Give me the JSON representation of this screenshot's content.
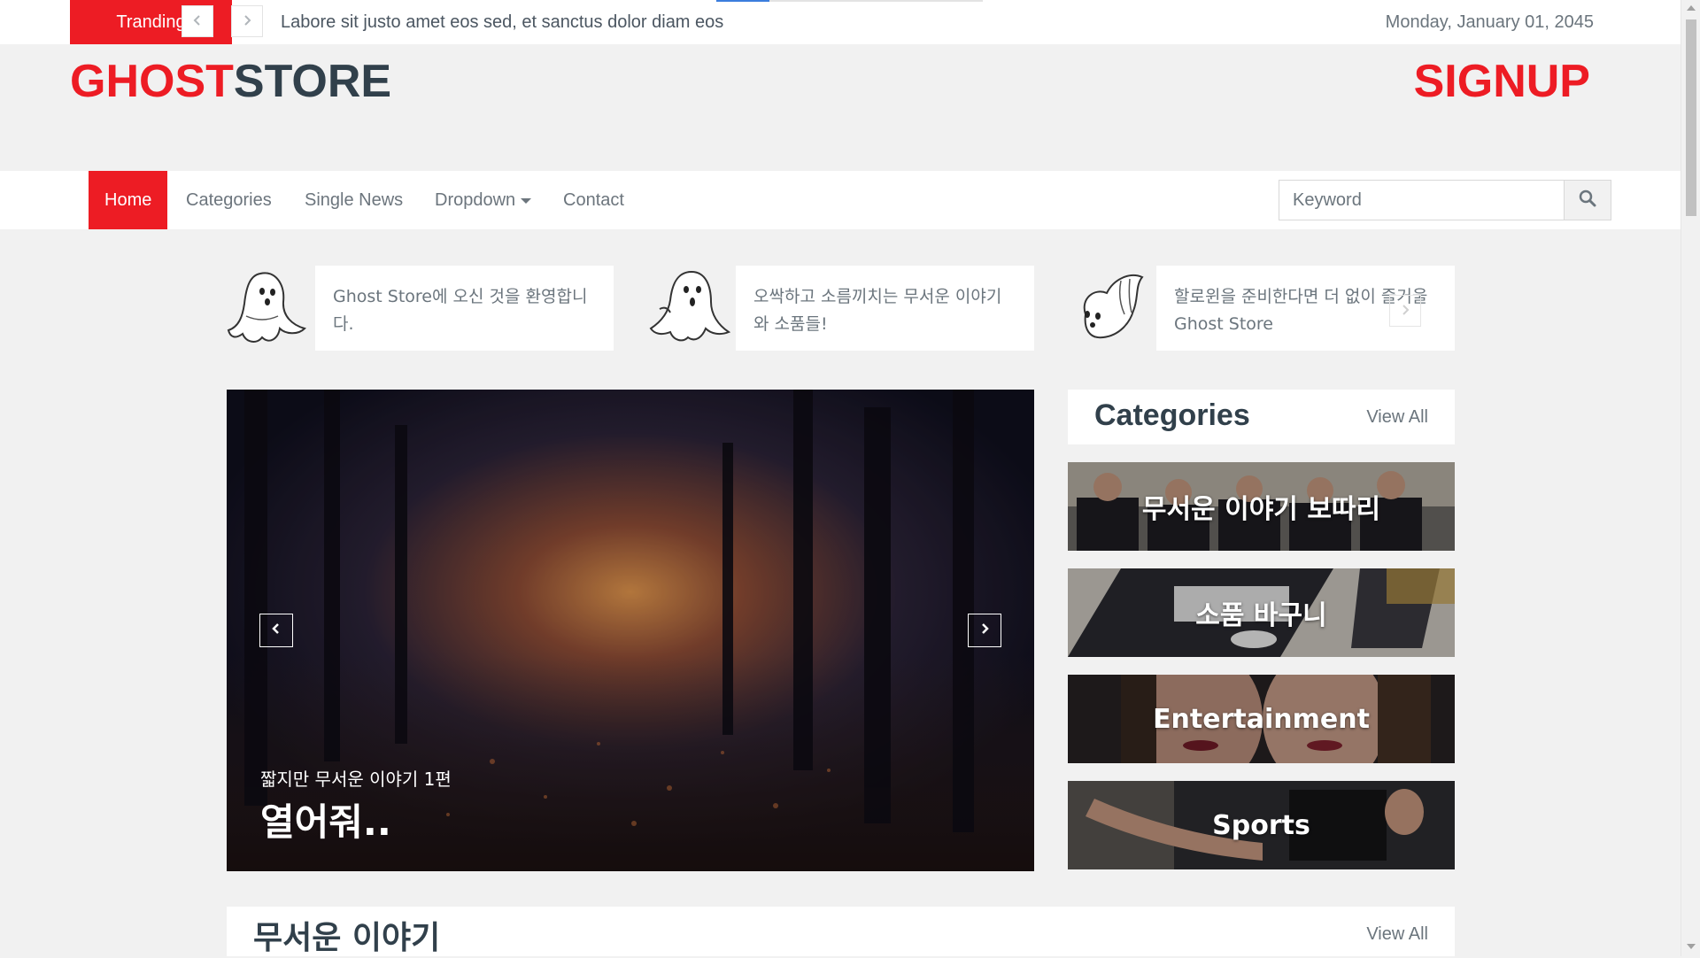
{
  "topbar": {
    "trending_label": "Tranding",
    "prev_icon": "chevron-left-icon",
    "next_icon": "chevron-right-icon",
    "headline": "Labore sit justo amet eos sed, et sanctus dolor diam eos",
    "date": "Monday, January 01, 2045"
  },
  "brand": {
    "part1": "GHOST",
    "part2": "STORE",
    "accent": "#ed1c24",
    "dark": "#31404b"
  },
  "signup_label": "SIGNUP",
  "nav": {
    "items": [
      {
        "label": "Home",
        "active": true
      },
      {
        "label": "Categories"
      },
      {
        "label": "Single News"
      },
      {
        "label": "Dropdown"
      },
      {
        "label": "Contact"
      }
    ],
    "search_placeholder": "Keyword",
    "search_icon": "search-icon"
  },
  "features": [
    {
      "text": "Ghost Store에 오신 것을 환영합니다.",
      "icon": "ghost-icon"
    },
    {
      "text": "오싹하고 소름끼치는 무서운 이야기와 소품들!",
      "icon": "ghost-icon"
    },
    {
      "text": "할로윈을 준비한다면 더 없이 즐거울 Ghost Store",
      "icon": "ghost-icon"
    }
  ],
  "hero": {
    "subtitle": "짧지만 무서운 이야기 1편",
    "title": "열어줘..",
    "prev_icon": "chevron-left-icon",
    "next_icon": "chevron-right-icon"
  },
  "categories": {
    "title": "Categories",
    "view_all": "View All",
    "items": [
      {
        "label": "무서운 이야기 보따리"
      },
      {
        "label": "소품 바구니"
      },
      {
        "label": "Entertainment"
      },
      {
        "label": "Sports"
      }
    ]
  },
  "section": {
    "title": "무서운 이야기",
    "view_all": "View All"
  }
}
